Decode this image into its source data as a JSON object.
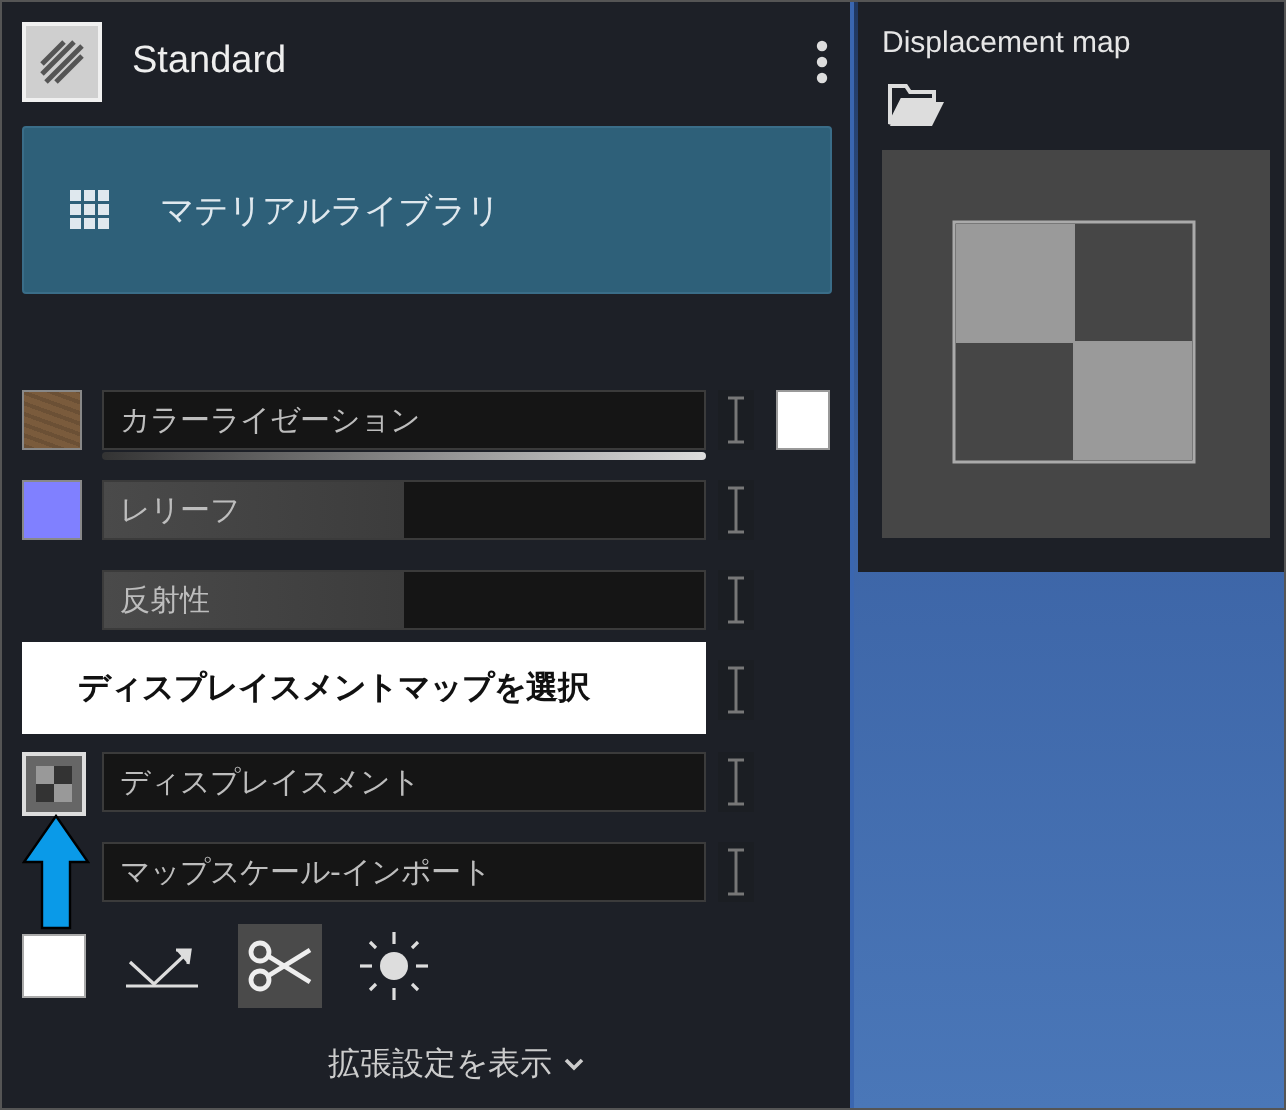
{
  "header": {
    "title": "Standard"
  },
  "library_button": {
    "label": "マテリアルライブラリ"
  },
  "channels": [
    {
      "kind": "field",
      "label": "カラーライゼーション",
      "swatch": {
        "kind": "texture",
        "color": "#7a5b3c"
      },
      "underline": true,
      "end_swatch": {
        "color": "#ffffff"
      }
    },
    {
      "kind": "slider",
      "label": "レリーフ",
      "swatch": {
        "kind": "color",
        "color": "#8080ff"
      },
      "level": 0.5
    },
    {
      "kind": "slider",
      "label": "反射性",
      "level": 0.5
    },
    {
      "kind": "tooltip",
      "label": "ディスプレイスメントマップを選択"
    },
    {
      "kind": "field",
      "label": "ディスプレイスメント",
      "swatch": {
        "kind": "checker"
      }
    },
    {
      "kind": "field",
      "label": "マップスケール-インポート",
      "swatch": {
        "kind": "arrow"
      }
    }
  ],
  "tools": [
    {
      "kind": "white-swatch",
      "selected": false
    },
    {
      "kind": "reflect",
      "selected": false
    },
    {
      "kind": "scissors",
      "selected": true
    },
    {
      "kind": "sun",
      "selected": false
    }
  ],
  "advanced_link": {
    "label": "拡張設定を表示"
  },
  "popup": {
    "title": "Displacement map"
  }
}
